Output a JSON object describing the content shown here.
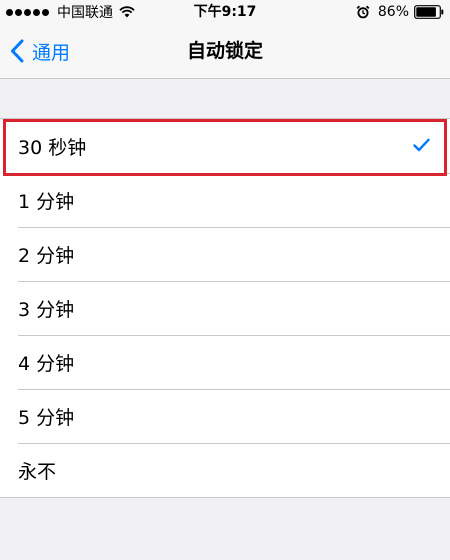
{
  "status_bar": {
    "carrier": "中国联通",
    "time": "下午9:17",
    "battery": "86%",
    "icons": [
      "signal-dots-icon",
      "wifi-icon",
      "alarm-icon",
      "battery-icon"
    ]
  },
  "nav": {
    "back_label": "通用",
    "title": "自动锁定"
  },
  "options": [
    {
      "label": "30 秒钟",
      "selected": true
    },
    {
      "label": "1 分钟",
      "selected": false
    },
    {
      "label": "2 分钟",
      "selected": false
    },
    {
      "label": "3 分钟",
      "selected": false
    },
    {
      "label": "4 分钟",
      "selected": false
    },
    {
      "label": "5 分钟",
      "selected": false
    },
    {
      "label": "永不",
      "selected": false
    }
  ],
  "colors": {
    "accent": "#007aff",
    "highlight": "#d9232e",
    "background": "#efeff4"
  }
}
